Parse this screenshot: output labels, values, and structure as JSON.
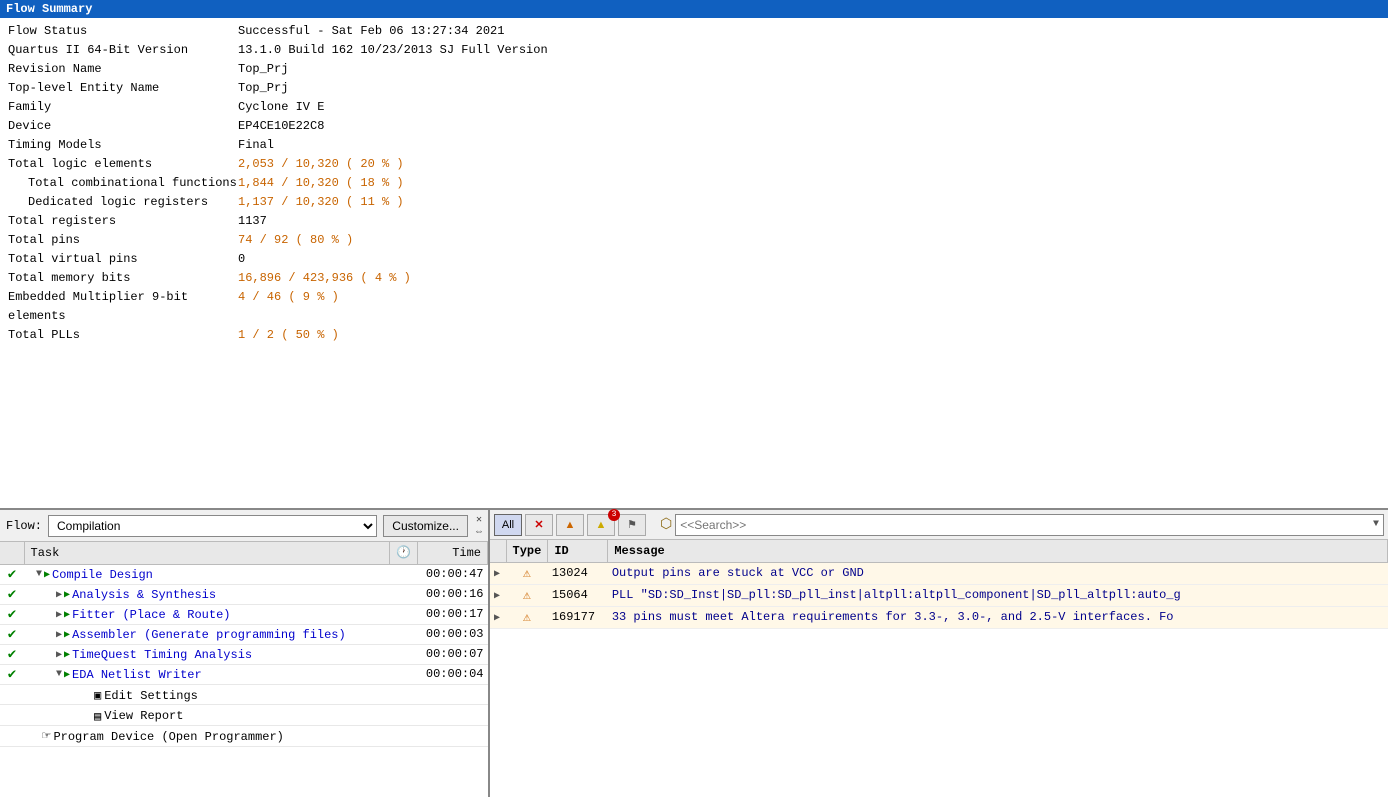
{
  "header": {
    "title": "Flow Summary"
  },
  "summary": {
    "rows": [
      {
        "label": "Flow Status",
        "value": "Successful - Sat Feb 06 13:27:34 2021",
        "indent": 0,
        "color": ""
      },
      {
        "label": "Quartus II 64-Bit Version",
        "value": "13.1.0 Build 162 10/23/2013 SJ Full Version",
        "indent": 0,
        "color": ""
      },
      {
        "label": "Revision Name",
        "value": "Top_Prj",
        "indent": 0,
        "color": ""
      },
      {
        "label": "Top-level Entity Name",
        "value": "Top_Prj",
        "indent": 0,
        "color": ""
      },
      {
        "label": "Family",
        "value": "Cyclone IV E",
        "indent": 0,
        "color": ""
      },
      {
        "label": "Device",
        "value": "EP4CE10E22C8",
        "indent": 0,
        "color": ""
      },
      {
        "label": "Timing Models",
        "value": "Final",
        "indent": 0,
        "color": ""
      },
      {
        "label": "Total logic elements",
        "value": "2,053 / 10,320 ( 20 % )",
        "indent": 0,
        "color": "orange"
      },
      {
        "label": "Total combinational functions",
        "value": "1,844 / 10,320 ( 18 % )",
        "indent": 1,
        "color": "orange"
      },
      {
        "label": "Dedicated logic registers",
        "value": "1,137 / 10,320 ( 11 % )",
        "indent": 1,
        "color": "orange"
      },
      {
        "label": "Total registers",
        "value": "1137",
        "indent": 0,
        "color": ""
      },
      {
        "label": "Total pins",
        "value": "74 / 92 ( 80 % )",
        "indent": 0,
        "color": "orange"
      },
      {
        "label": "Total virtual pins",
        "value": "0",
        "indent": 0,
        "color": ""
      },
      {
        "label": "Total memory bits",
        "value": "16,896 / 423,936 ( 4 % )",
        "indent": 0,
        "color": "orange"
      },
      {
        "label": "Embedded Multiplier 9-bit elements",
        "value": "4 / 46 ( 9 % )",
        "indent": 0,
        "color": "orange"
      },
      {
        "label": "Total PLLs",
        "value": "1 / 2 ( 50 % )",
        "indent": 0,
        "color": "orange"
      }
    ]
  },
  "compilation": {
    "flow_label": "Flow:",
    "flow_value": "Compilation",
    "customize_label": "Customize...",
    "task_col": "Task",
    "time_col": "Time",
    "tasks": [
      {
        "id": "compile-design",
        "status": "check",
        "expand": "down",
        "indent": 1,
        "name": "Compile Design",
        "time": "00:00:47",
        "color": "blue"
      },
      {
        "id": "analysis-synthesis",
        "status": "check",
        "expand": "right",
        "indent": 2,
        "name": "Analysis & Synthesis",
        "time": "00:00:16",
        "color": "blue"
      },
      {
        "id": "fitter",
        "status": "check",
        "expand": "right",
        "indent": 2,
        "name": "Fitter (Place & Route)",
        "time": "00:00:17",
        "color": "blue"
      },
      {
        "id": "assembler",
        "status": "check",
        "expand": "right",
        "indent": 2,
        "name": "Assembler (Generate programming files)",
        "time": "00:00:03",
        "color": "blue"
      },
      {
        "id": "timequest",
        "status": "check",
        "expand": "right",
        "indent": 2,
        "name": "TimeQuest Timing Analysis",
        "time": "00:00:07",
        "color": "blue"
      },
      {
        "id": "eda-netlist",
        "status": "check",
        "expand": "down",
        "indent": 2,
        "name": "EDA Netlist Writer",
        "time": "00:00:04",
        "color": "blue"
      },
      {
        "id": "edit-settings",
        "status": "",
        "expand": "",
        "indent": 3,
        "name": "Edit Settings",
        "time": "",
        "color": "black"
      },
      {
        "id": "view-report",
        "status": "",
        "expand": "",
        "indent": 3,
        "name": "View Report",
        "time": "",
        "color": "black"
      },
      {
        "id": "program-device",
        "status": "",
        "expand": "",
        "indent": 0,
        "name": "Program Device (Open Programmer)",
        "time": "",
        "color": "black",
        "icon": "hand"
      }
    ]
  },
  "messages": {
    "buttons": {
      "all": "All",
      "error_icon": "✕",
      "warning_icon": "▲",
      "info_icon": "▲",
      "filter_icon": "⬡"
    },
    "search_placeholder": "<<Search>>",
    "badge_count": "3",
    "columns": [
      "Type",
      "ID",
      "Message"
    ],
    "rows": [
      {
        "id": "msg-1",
        "expand": "▶",
        "type": "warning",
        "msg_id": "13024",
        "text": "Output pins are stuck at VCC or GND"
      },
      {
        "id": "msg-2",
        "expand": "▶",
        "type": "warning",
        "msg_id": "15064",
        "text": "PLL \"SD:SD_Inst|SD_pll:SD_pll_inst|altpll:altpll_component|SD_pll_altpll:auto_g"
      },
      {
        "id": "msg-3",
        "expand": "▶",
        "type": "warning",
        "msg_id": "169177",
        "text": "33 pins must meet Altera requirements for 3.3-, 3.0-, and 2.5-V interfaces. Fo"
      }
    ]
  }
}
